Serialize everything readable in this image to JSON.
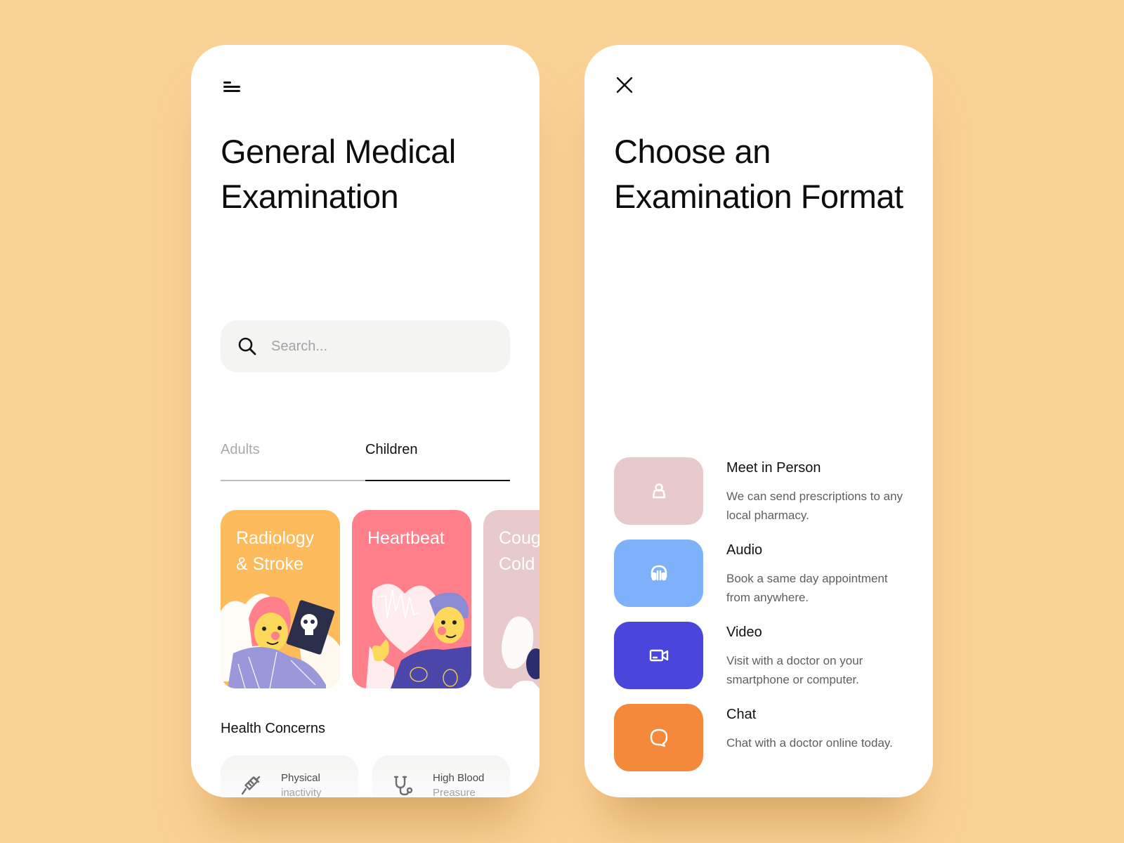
{
  "colors": {
    "background": "#fbd295",
    "card_radiology": "#fdbb5c",
    "card_heartbeat": "#ff7f8a",
    "card_cough": "#e8cacc",
    "tile_person": "#e8cacc",
    "tile_audio": "#7db1fa",
    "tile_video": "#4a46dc",
    "tile_chat": "#f4893b"
  },
  "left_screen": {
    "menu_icon": "menu-icon",
    "title_line1": "General Medical",
    "title_line2": "Examination",
    "search": {
      "icon": "search-icon",
      "placeholder": "Search...",
      "value": ""
    },
    "tabs": [
      {
        "label": "Adults",
        "active": false
      },
      {
        "label": "Children",
        "active": true
      }
    ],
    "categories": [
      {
        "label": "Radiology\n& Stroke",
        "illustration": "person-holding-xray"
      },
      {
        "label": "Heartbeat",
        "illustration": "person-with-heart-ecg"
      },
      {
        "label": "Cough\nCold",
        "illustration": "person-coughing"
      }
    ],
    "health_concerns": {
      "title": "Health Concerns",
      "items": [
        {
          "icon": "syringe-icon",
          "line1": "Physical",
          "line2": "inactivity"
        },
        {
          "icon": "stethoscope-icon",
          "line1": "High Blood",
          "line2": "Preasure"
        }
      ]
    }
  },
  "right_screen": {
    "close_icon": "close-icon",
    "title_line1": "Choose an",
    "title_line2": "Examination Format",
    "formats": [
      {
        "icon": "person-icon",
        "name": "Meet in Person",
        "description": "We can send prescriptions to any local pharmacy."
      },
      {
        "icon": "headphones-icon",
        "name": "Audio",
        "description": "Book a same day appointment from anywhere."
      },
      {
        "icon": "video-camera-icon",
        "name": "Video",
        "description": "Visit with a doctor on your smartphone or computer."
      },
      {
        "icon": "chat-bubble-icon",
        "name": "Chat",
        "description": "Chat with a doctor online today."
      }
    ]
  }
}
